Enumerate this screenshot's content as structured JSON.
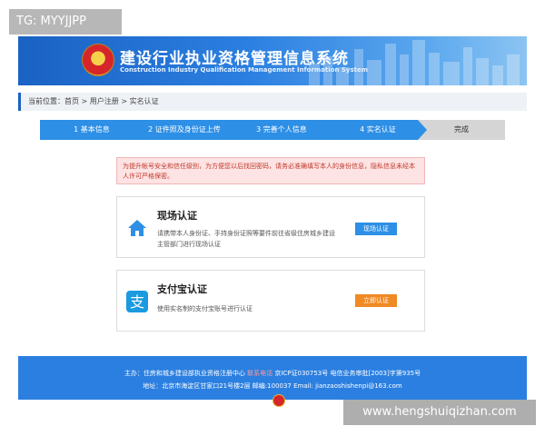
{
  "watermark_top": "TG: MYYJJPP",
  "watermark_bottom": "www.hengshuiqizhan.com",
  "header": {
    "title_cn": "建设行业执业资格管理信息系统",
    "title_en": "Construction Industry Qualification Management Information System"
  },
  "breadcrumb": "当前位置：首页 > 用户注册 > 实名认证",
  "steps": [
    {
      "label": "1 基本信息"
    },
    {
      "label": "2 证件照及身份证上传"
    },
    {
      "label": "3 完善个人信息"
    },
    {
      "label": "4 实名认证"
    },
    {
      "label": "完成"
    }
  ],
  "notice": "为提升帐号安全和信任级别，为方便您以后找回密码，请务必准确填写本人的身份信息，隐私信息未经本人许可严格保密。",
  "cards": {
    "onsite": {
      "title": "现场认证",
      "desc": "请携带本人身份证、手持身份证照等要件前往省级住房城乡建设主管部门进行现场认证",
      "button": "现场认证",
      "icon": "house-icon"
    },
    "alipay": {
      "title": "支付宝认证",
      "desc": "使用实名制的支付宝账号进行认证",
      "button": "立即认证",
      "icon": "alipay-icon"
    }
  },
  "footer": {
    "line1_a": "主办：住房和城乡建设部执业资格注册中心",
    "line1_link": "联系电话",
    "line1_b": "京ICP证030753号   电信业务审批[2003]字第935号",
    "line2": "地址：北京市海淀区甘家口21号楼2层  邮编:100037  Email: jianzaoshishenpi@163.com"
  },
  "colors": {
    "primary": "#2d8fe6",
    "header_blue": "#1a62c4",
    "orange": "#f08a24",
    "notice_bg": "#fde3e3",
    "notice_text": "#c0392b"
  }
}
